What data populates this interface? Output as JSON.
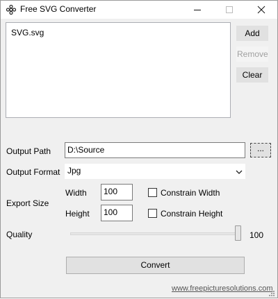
{
  "window": {
    "title": "Free SVG Converter"
  },
  "file_list": {
    "items": [
      "SVG.svg"
    ]
  },
  "buttons": {
    "add": "Add",
    "remove": "Remove",
    "clear": "Clear",
    "browse": "...",
    "convert": "Convert"
  },
  "output_path": {
    "label": "Output Path",
    "value": "D:\\Source"
  },
  "output_format": {
    "label": "Output Format",
    "selected": "Jpg"
  },
  "export_size": {
    "label": "Export Size",
    "width_label": "Width",
    "width_value": "100",
    "height_label": "Height",
    "height_value": "100",
    "constrain_width_label": "Constrain Width",
    "constrain_width_checked": false,
    "constrain_height_label": "Constrain Height",
    "constrain_height_checked": false
  },
  "quality": {
    "label": "Quality",
    "value_text": "100",
    "level_percent": 100
  },
  "footer": {
    "website": "www.freepicturesolutions.com"
  },
  "icons": {
    "app": "gear-flower-icon",
    "minimize": "minimize-icon",
    "maximize": "maximize-icon",
    "close": "close-icon",
    "dropdown": "chevron-down-icon"
  }
}
